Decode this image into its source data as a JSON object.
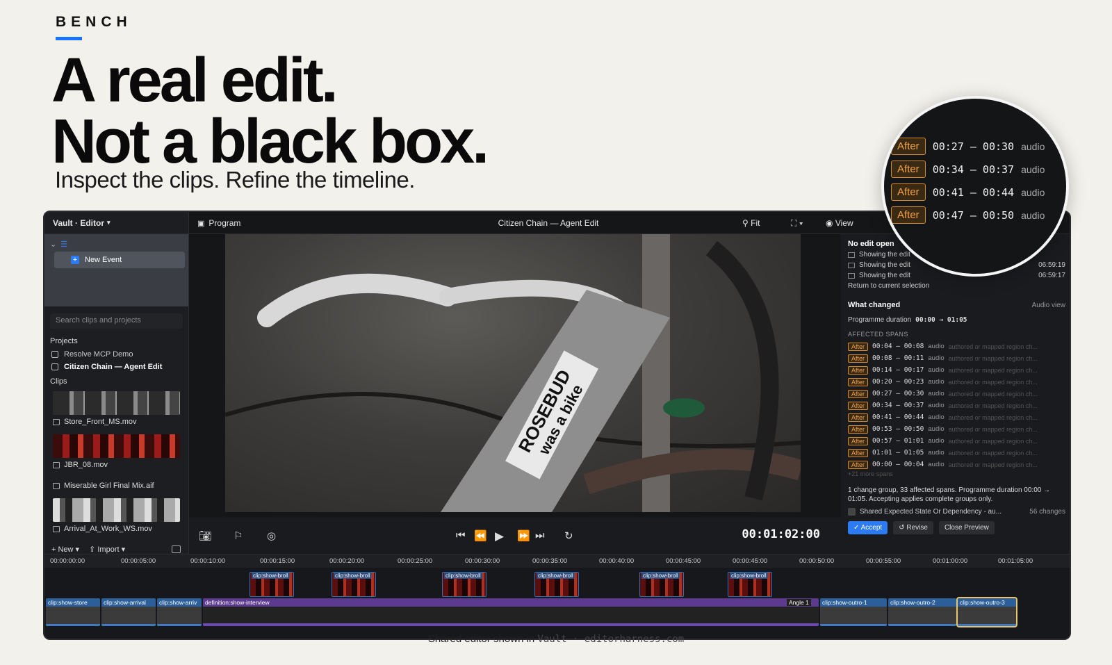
{
  "brand": "BENCH",
  "headline": {
    "line1": "A real edit.",
    "line2": "Not a black box."
  },
  "subhead": "Inspect the clips. Refine the timeline.",
  "editor": {
    "workspace": "Vault · Editor",
    "program_label": "Program",
    "title": "Citizen Chain — Agent Edit",
    "fit_label": "Fit",
    "view_label": "View",
    "new_event": "New Event",
    "search_placeholder": "Search clips and projects",
    "projects_label": "Projects",
    "projects": [
      "Resolve MCP Demo",
      "Citizen Chain — Agent Edit"
    ],
    "clips_label": "Clips",
    "clips": [
      "Store_Front_MS.mov",
      "JBR_08.mov",
      "Miserable Girl Final Mix.aif",
      "Arrival_At_Work_WS.mov"
    ],
    "new_label": "New",
    "import_label": "Import",
    "timecode": "00:01:02:00"
  },
  "inspector": {
    "no_edit": "No edit open",
    "showing": [
      {
        "label": "Showing the edit",
        "time": ""
      },
      {
        "label": "Showing the edit",
        "time": "06:59:19"
      },
      {
        "label": "Showing the edit",
        "time": "06:59:17"
      }
    ],
    "return_label": "Return to current selection",
    "what_changed": "What changed",
    "audio_view": "Audio view",
    "duration_label": "Programme duration",
    "duration_value": "00:00 → 01:05",
    "affected_label": "AFFECTED SPANS",
    "spans": [
      {
        "badge": "After",
        "time": "00:04 – 00:08",
        "type": "audio",
        "note": "authored or mapped region ch..."
      },
      {
        "badge": "After",
        "time": "00:08 – 00:11",
        "type": "audio",
        "note": "authored or mapped region ch..."
      },
      {
        "badge": "After",
        "time": "00:14 – 00:17",
        "type": "audio",
        "note": "authored or mapped region ch..."
      },
      {
        "badge": "After",
        "time": "00:20 – 00:23",
        "type": "audio",
        "note": "authored or mapped region ch..."
      },
      {
        "badge": "After",
        "time": "00:27 – 00:30",
        "type": "audio",
        "note": "authored or mapped region ch..."
      },
      {
        "badge": "After",
        "time": "00:34 – 00:37",
        "type": "audio",
        "note": "authored or mapped region ch..."
      },
      {
        "badge": "After",
        "time": "00:41 – 00:44",
        "type": "audio",
        "note": "authored or mapped region ch..."
      },
      {
        "badge": "After",
        "time": "00:53 – 00:50",
        "type": "audio",
        "note": "authored or mapped region ch..."
      },
      {
        "badge": "After",
        "time": "00:57 – 01:01",
        "type": "audio",
        "note": "authored or mapped region ch..."
      },
      {
        "badge": "After",
        "time": "01:01 – 01:05",
        "type": "audio",
        "note": "authored or mapped region ch..."
      },
      {
        "badge": "After",
        "time": "00:00 – 00:04",
        "type": "audio",
        "note": "authored or mapped region ch..."
      }
    ],
    "more_spans": "+21 more spans",
    "summary": "1 change group, 33 affected spans. Programme duration 00:00 → 01:05. Accepting applies complete groups only.",
    "dependency": "Shared Expected State Or Dependency - au...",
    "changes_count": "56 changes",
    "accept": "Accept",
    "revise": "Revise",
    "close_preview": "Close Preview"
  },
  "ruler": [
    "00:00:00:00",
    "00:00:05:00",
    "00:00:10:00",
    "00:00:15:00",
    "00:00:20:00",
    "00:00:25:00",
    "00:00:30:00",
    "00:00:35:00",
    "00:00:40:00",
    "00:00:45:00",
    "00:00:45:00",
    "00:00:50:00",
    "00:00:55:00",
    "00:01:00:00",
    "00:01:05:00"
  ],
  "broll_label": "clip:show-broll",
  "track_clips": {
    "store": "clip:show-store",
    "arrival": "clip:show-arrival",
    "arrival2": "clip:show-arriv",
    "interview": "definition:show-interview",
    "angle": "Angle 1",
    "outro1": "clip:show-outro-1",
    "outro2": "clip:show-outro-2",
    "outro3": "clip:show-outro-3"
  },
  "magnifier": [
    {
      "badge": "After",
      "time": "00:27 – 00:30",
      "type": "audio"
    },
    {
      "badge": "After",
      "time": "00:34 – 00:37",
      "type": "audio"
    },
    {
      "badge": "After",
      "time": "00:41 – 00:44",
      "type": "audio"
    },
    {
      "badge": "After",
      "time": "00:47 – 00:50",
      "type": "audio"
    }
  ],
  "footer": {
    "text": "Shared editor shown in",
    "product": "Vault · editorharness.com"
  },
  "colors": {
    "accent": "#2c7bf2",
    "after_badge": "#f3a347",
    "brand_bar": "#1a73ff"
  }
}
